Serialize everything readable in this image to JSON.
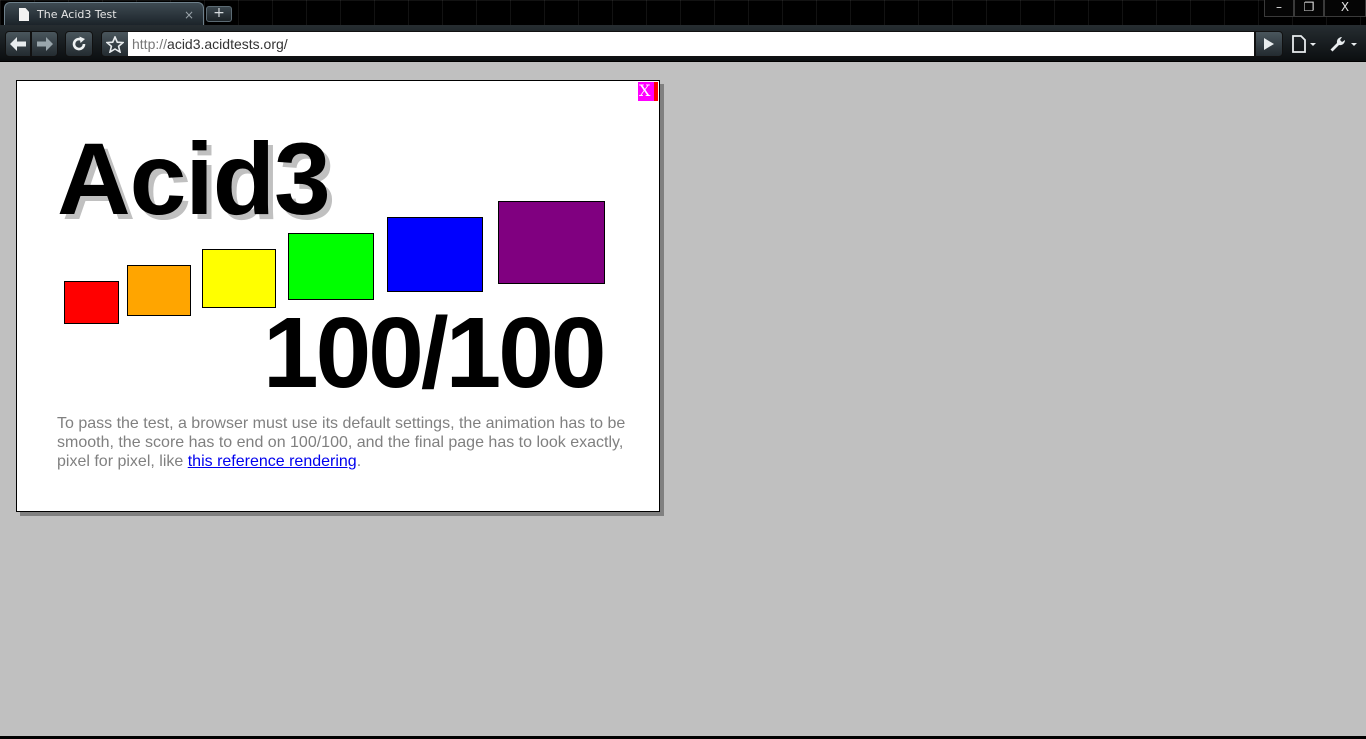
{
  "browser": {
    "tab": {
      "title": "The Acid3 Test",
      "close_glyph": "×"
    },
    "new_tab_glyph": "+",
    "window_controls": {
      "minimize": "–",
      "restore": "❐",
      "close": "X"
    },
    "address_bar": {
      "prefix": "http://",
      "host_path": "acid3.acidtests.org/"
    },
    "icons": [
      "back-arrow-icon",
      "forward-arrow-icon",
      "reload-icon",
      "star-icon",
      "go-arrow-icon",
      "page-menu-icon",
      "wrench-icon"
    ]
  },
  "page": {
    "close_label": "X",
    "title": "Acid3",
    "score": "100/100",
    "instructions": {
      "text": "To pass the test, a browser must use its default settings, the animation has to be smooth, the score has to end on 100/100, and the final page has to look exactly, pixel for pixel, like ",
      "link_text": "this reference rendering",
      "suffix": "."
    },
    "buckets": [
      {
        "name": "bucket-1",
        "color": "#ff0000"
      },
      {
        "name": "bucket-2",
        "color": "#ffa500"
      },
      {
        "name": "bucket-3",
        "color": "#ffff00"
      },
      {
        "name": "bucket-4",
        "color": "#00ff00"
      },
      {
        "name": "bucket-5",
        "color": "#0000ff"
      },
      {
        "name": "bucket-6",
        "color": "#800080"
      }
    ],
    "colors": {
      "background": "#c0c0c0",
      "text_gray": "#808080",
      "link": "#0000ee"
    }
  }
}
